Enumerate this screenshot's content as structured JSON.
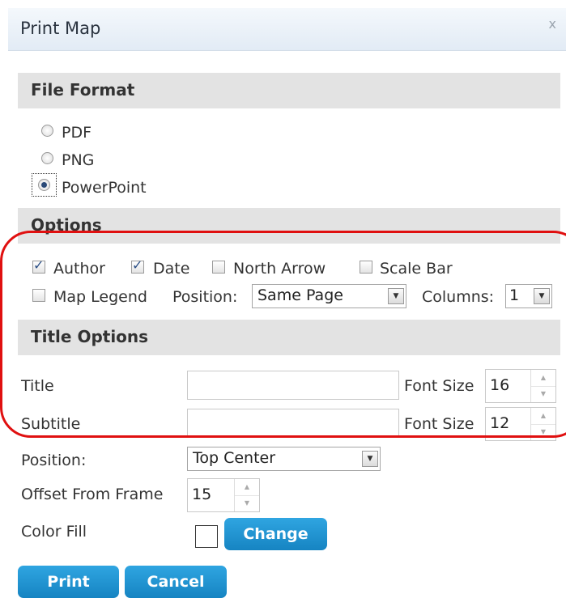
{
  "dialog": {
    "title": "Print Map",
    "close_glyph": "x"
  },
  "file_format": {
    "heading": "File Format",
    "options": [
      {
        "label": "PDF",
        "selected": false
      },
      {
        "label": "PNG",
        "selected": false
      },
      {
        "label": "PowerPoint",
        "selected": true
      }
    ]
  },
  "options": {
    "heading": "Options",
    "author": {
      "label": "Author",
      "checked": true
    },
    "date": {
      "label": "Date",
      "checked": true
    },
    "north_arrow": {
      "label": "North Arrow",
      "checked": false
    },
    "scale_bar": {
      "label": "Scale Bar",
      "checked": false
    },
    "map_legend": {
      "label": "Map Legend",
      "checked": false
    },
    "position_label": "Position:",
    "position_value": "Same Page",
    "columns_label": "Columns:",
    "columns_value": "1"
  },
  "title_options": {
    "heading": "Title Options",
    "title_label": "Title",
    "title_value": "",
    "title_font_label": "Font Size",
    "title_font_size": "16",
    "subtitle_label": "Subtitle",
    "subtitle_value": "",
    "subtitle_font_label": "Font Size",
    "subtitle_font_size": "12",
    "position_label": "Position:",
    "position_value": "Top Center",
    "offset_label": "Offset From Frame",
    "offset_value": "15",
    "color_fill_label": "Color Fill",
    "change_label": "Change"
  },
  "actions": {
    "print_label": "Print",
    "cancel_label": "Cancel"
  },
  "colors": {
    "accent": "#1e90d0",
    "highlight": "#e01010",
    "section_bg": "#e3e3e3"
  }
}
